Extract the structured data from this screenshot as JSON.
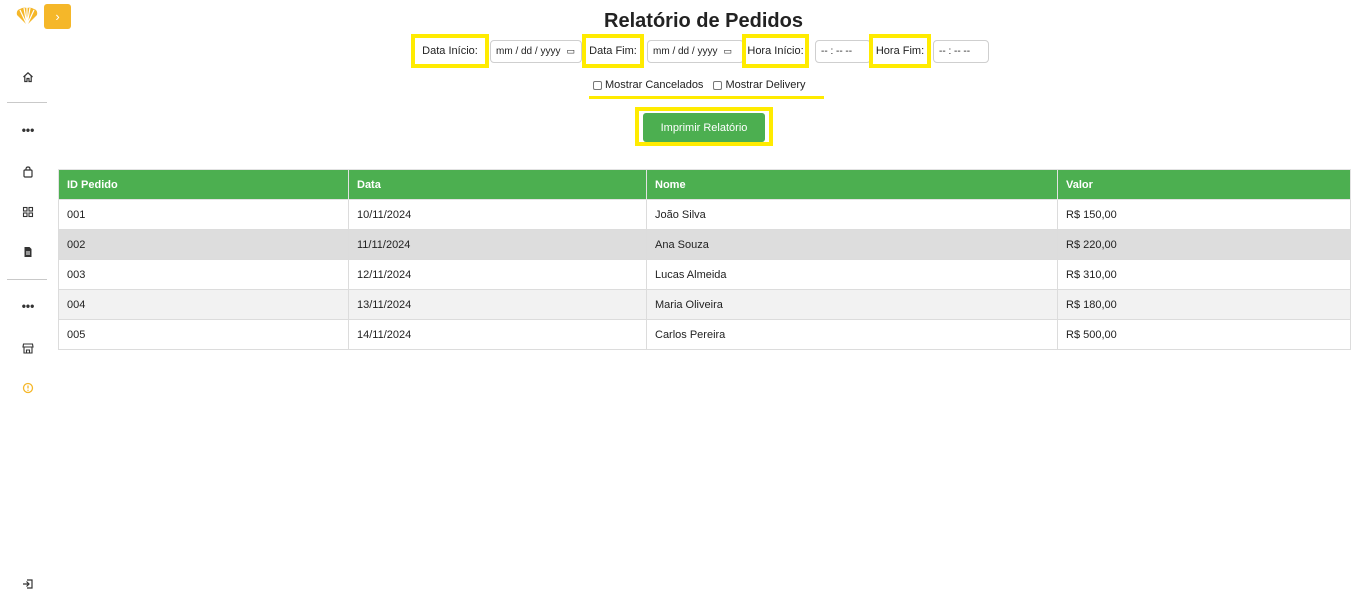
{
  "sidebar": {
    "toggle_label": "›",
    "items": [
      {
        "name": "home-icon"
      },
      {
        "name": "more-icon"
      },
      {
        "name": "bag-icon"
      },
      {
        "name": "grid-icon"
      },
      {
        "name": "document-icon"
      },
      {
        "name": "more-icon"
      },
      {
        "name": "store-icon"
      },
      {
        "name": "info-icon"
      },
      {
        "name": "logout-icon"
      }
    ],
    "accent": "#f5b729"
  },
  "page": {
    "title": "Relatório de Pedidos"
  },
  "filters": {
    "data_inicio_label": "Data Início:",
    "data_inicio_placeholder": "mm / dd / yyyy",
    "data_fim_label": "Data Fim:",
    "data_fim_placeholder": "mm / dd / yyyy",
    "hora_inicio_label": "Hora Início:",
    "hora_inicio_placeholder": "-- : --   --",
    "hora_fim_label": "Hora Fim:",
    "hora_fim_placeholder": "-- : --   --",
    "mostrar_cancelados": "Mostrar Cancelados",
    "mostrar_delivery": "Mostrar Delivery"
  },
  "actions": {
    "print_label": "Imprimir Relatório"
  },
  "table": {
    "headers": [
      "ID Pedido",
      "Data",
      "Nome",
      "Valor"
    ],
    "rows": [
      [
        "001",
        "10/11/2024",
        "João Silva",
        "R$ 150,00"
      ],
      [
        "002",
        "11/11/2024",
        "Ana Souza",
        "R$ 220,00"
      ],
      [
        "003",
        "12/11/2024",
        "Lucas Almeida",
        "R$ 310,00"
      ],
      [
        "004",
        "13/11/2024",
        "Maria Oliveira",
        "R$ 180,00"
      ],
      [
        "005",
        "14/11/2024",
        "Carlos Pereira",
        "R$ 500,00"
      ]
    ]
  },
  "colors": {
    "header_green": "#4caf50",
    "highlight_yellow": "#ffeb00",
    "brand_orange": "#f5b729"
  }
}
